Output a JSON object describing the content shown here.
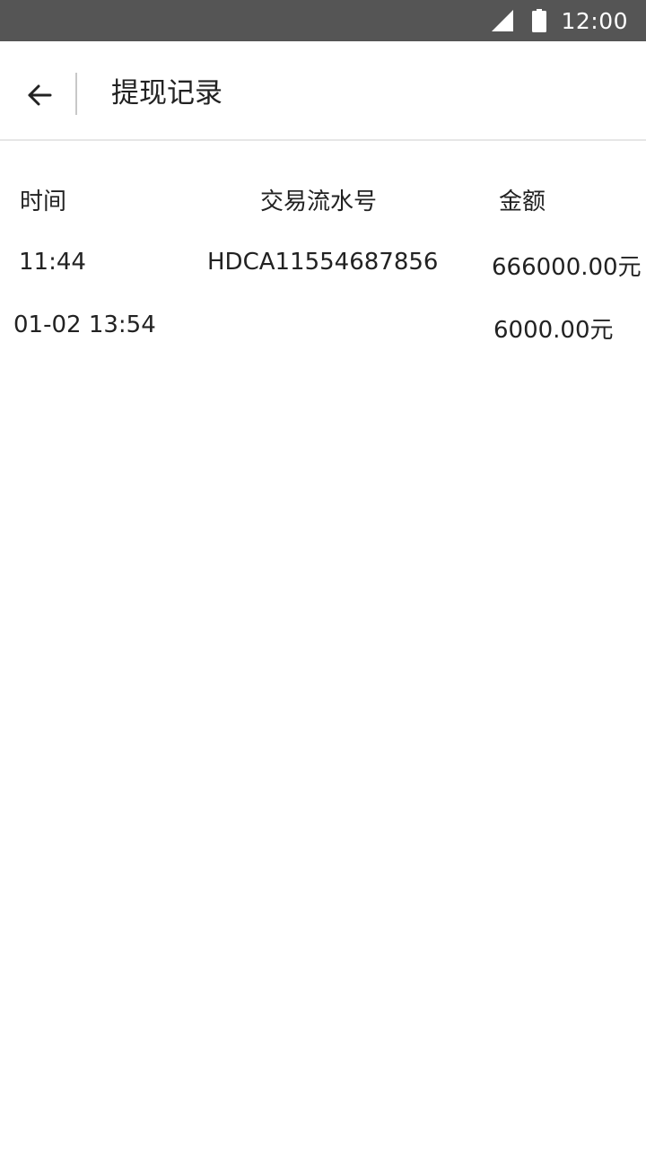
{
  "status_bar": {
    "time": "12:00",
    "icons": [
      "cellular-signal-icon",
      "battery-icon"
    ]
  },
  "app_bar": {
    "back_icon": "arrow-left-icon",
    "title": "提现记录"
  },
  "table": {
    "headers": {
      "time": "时间",
      "serial": "交易流水号",
      "amount": "金额"
    },
    "rows": [
      {
        "time": "11:44",
        "serial": "HDCA11554687856",
        "amount": "666000.00元"
      },
      {
        "time": "01-02 13:54",
        "serial": "",
        "amount": "6000.00元"
      }
    ]
  },
  "colors": {
    "status_bar_bg": "#555555",
    "text": "#222222",
    "divider": "#e6e6e6",
    "background": "#ffffff"
  }
}
